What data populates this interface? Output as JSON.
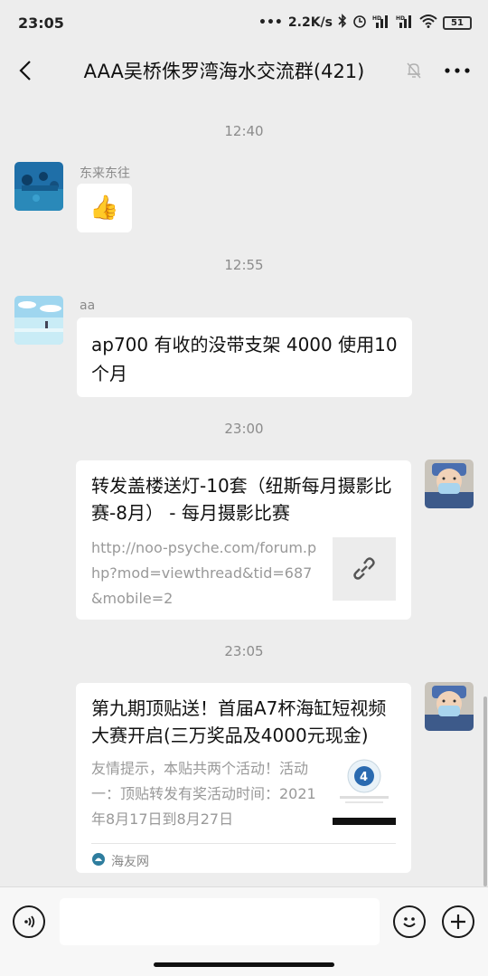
{
  "status_bar": {
    "time": "23:05",
    "network_speed": "2.2K/s",
    "battery": "51"
  },
  "header": {
    "title": "AAA吴桥侏罗湾海水交流群(421)"
  },
  "messages": [
    {
      "type": "time",
      "text": "12:40"
    },
    {
      "type": "incoming",
      "sender": "东来东往",
      "content": "👍"
    },
    {
      "type": "time",
      "text": "12:55"
    },
    {
      "type": "incoming",
      "sender": "aa",
      "content": "ap700 有收的没带支架 4000 使用10 个月"
    },
    {
      "type": "time",
      "text": "23:00"
    },
    {
      "type": "outgoing-link",
      "title": "转发盖楼送灯-10套（纽斯每月摄影比赛-8月） - 每月摄影比赛",
      "url": "http://noo-psyche.com/forum.php?mod=viewthread&tid=687&mobile=2"
    },
    {
      "type": "time",
      "text": "23:05"
    },
    {
      "type": "outgoing-card",
      "title": "第九期顶贴送！首届A7杯海缸短视频大赛开启(三万奖品及4000元现金)",
      "desc": "友情提示，本贴共两个活动！活动一：顶贴转发有奖活动时间：2021年8月17日到8月27日",
      "source": "海友网"
    }
  ]
}
